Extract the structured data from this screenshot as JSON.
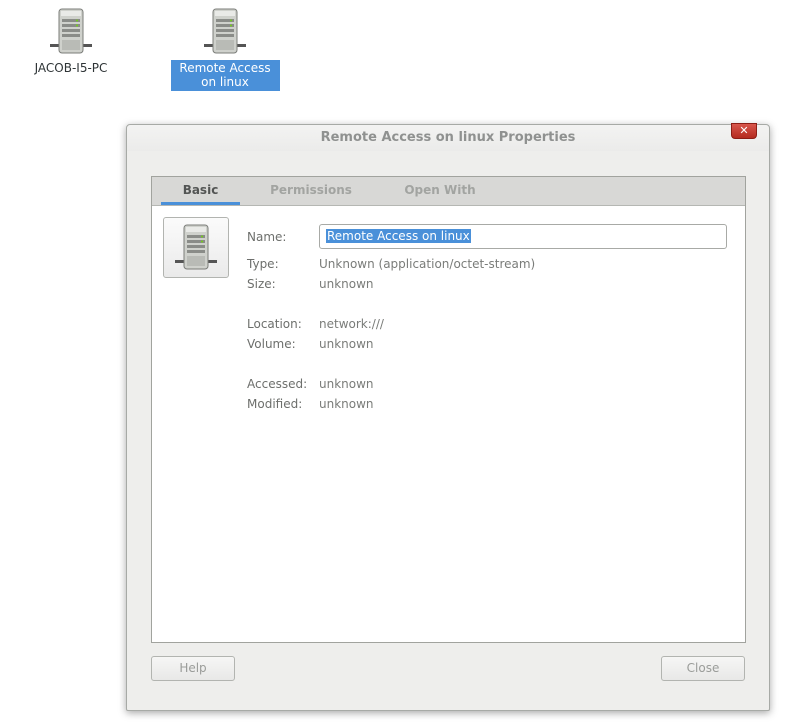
{
  "desktop": {
    "icons": [
      {
        "label": "JACOB-I5-PC",
        "icon": "network-server-icon",
        "selected": false
      },
      {
        "label": "Remote Access on linux",
        "icon": "network-server-icon",
        "selected": true
      }
    ]
  },
  "dialog": {
    "title": "Remote Access on linux Properties",
    "close_label": "✕",
    "tabs": [
      {
        "label": "Basic",
        "active": true
      },
      {
        "label": "Permissions",
        "active": false
      },
      {
        "label": "Open With",
        "active": false
      }
    ],
    "basic": {
      "icon": "network-server-icon",
      "name_label": "Name:",
      "name_value": "Remote Access on linux",
      "type_label": "Type:",
      "type_value": "Unknown (application/octet-stream)",
      "size_label": "Size:",
      "size_value": "unknown",
      "location_label": "Location:",
      "location_value": "network:///",
      "volume_label": "Volume:",
      "volume_value": "unknown",
      "accessed_label": "Accessed:",
      "accessed_value": "unknown",
      "modified_label": "Modified:",
      "modified_value": "unknown"
    },
    "buttons": {
      "help_label": "Help",
      "close_label": "Close"
    }
  },
  "colors": {
    "selection": "#4a90d9",
    "close_button": "#c6372b"
  }
}
